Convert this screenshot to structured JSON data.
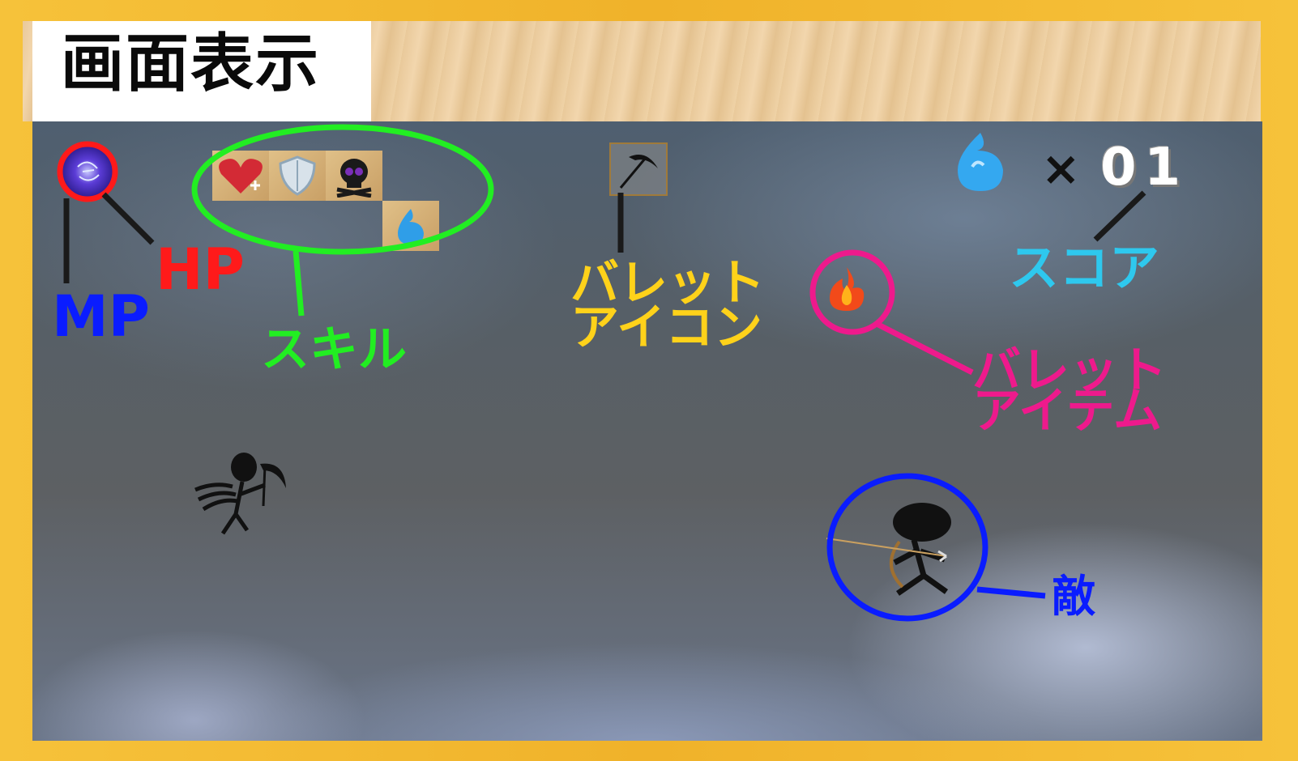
{
  "title": "画面表示",
  "hud": {
    "score_prefix": "×",
    "score_value": "01"
  },
  "labels": {
    "hp": "HP",
    "mp": "MP",
    "skill": "スキル",
    "bullet_icon_line1": "バレット",
    "bullet_icon_line2": "アイコン",
    "score": "スコア",
    "bullet_item_line1": "バレット",
    "bullet_item_line2": "アイテム",
    "enemy": "敵"
  },
  "skills": [
    {
      "icon": "heart-plus-icon"
    },
    {
      "icon": "shield-icon"
    },
    {
      "icon": "skull-icon"
    },
    {
      "icon": "blue-flame-icon"
    }
  ],
  "colors": {
    "hp": "#ff1a1a",
    "mp": "#0a1cff",
    "skill": "#22ee22",
    "bullet_icon": "#ffd21a",
    "score": "#2ec8ee",
    "bullet_item": "#ee1a8c",
    "enemy": "#0a1cff"
  }
}
